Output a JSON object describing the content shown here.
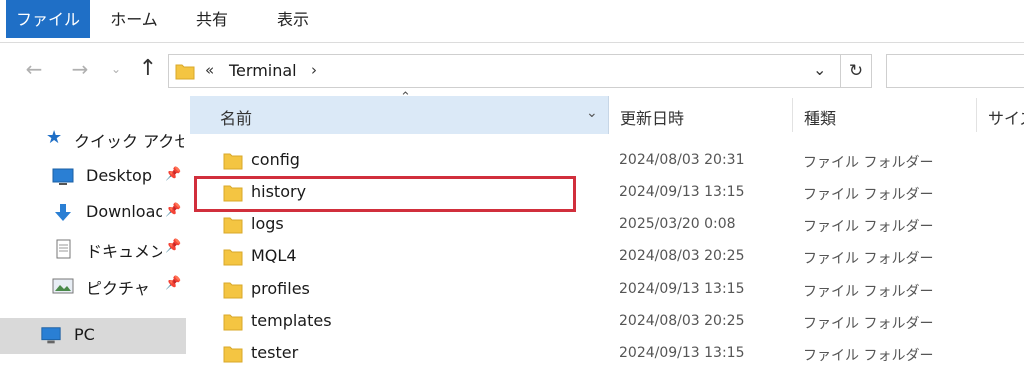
{
  "ribbon": {
    "tabs": [
      {
        "label": "ファイル",
        "active": true
      },
      {
        "label": "ホーム"
      },
      {
        "label": "共有"
      },
      {
        "label": "表示"
      }
    ],
    "accent": "#1f6fc6"
  },
  "address": {
    "overflow": "«",
    "segments": [
      "Terminal"
    ],
    "separator": "›"
  },
  "nav_icons": {
    "back": "arrow-left-icon",
    "forward": "arrow-right-icon",
    "recent": "chevron-down-icon",
    "up": "arrow-up-icon",
    "refresh": "refresh-icon"
  },
  "sidebar": {
    "quick_access": "クイック アクセス",
    "items": [
      {
        "label": "Desktop",
        "icon": "desktop-icon",
        "pinned": true
      },
      {
        "label": "Downloads",
        "icon": "download-icon",
        "pinned": true
      },
      {
        "label": "ドキュメント",
        "icon": "document-icon",
        "pinned": true
      },
      {
        "label": "ピクチャ",
        "icon": "picture-icon",
        "pinned": true
      }
    ],
    "pc": "PC"
  },
  "columns": {
    "name": "名前",
    "date": "更新日時",
    "type": "種類",
    "size": "サイズ"
  },
  "files": [
    {
      "name": "config",
      "date": "2024/08/03 20:31",
      "type": "ファイル フォルダー"
    },
    {
      "name": "history",
      "date": "2024/09/13 13:15",
      "type": "ファイル フォルダー",
      "highlighted": true
    },
    {
      "name": "logs",
      "date": "2025/03/20 0:08",
      "type": "ファイル フォルダー"
    },
    {
      "name": "MQL4",
      "date": "2024/08/03 20:25",
      "type": "ファイル フォルダー"
    },
    {
      "name": "profiles",
      "date": "2024/09/13 13:15",
      "type": "ファイル フォルダー"
    },
    {
      "name": "templates",
      "date": "2024/08/03 20:25",
      "type": "ファイル フォルダー"
    },
    {
      "name": "tester",
      "date": "2024/09/13 13:15",
      "type": "ファイル フォルダー"
    }
  ],
  "colors": {
    "folder": "#f4c542",
    "header_selected": "#dbe9f7",
    "highlight_box": "#d12f3c",
    "sidebar_selected": "#d9d9d9"
  }
}
